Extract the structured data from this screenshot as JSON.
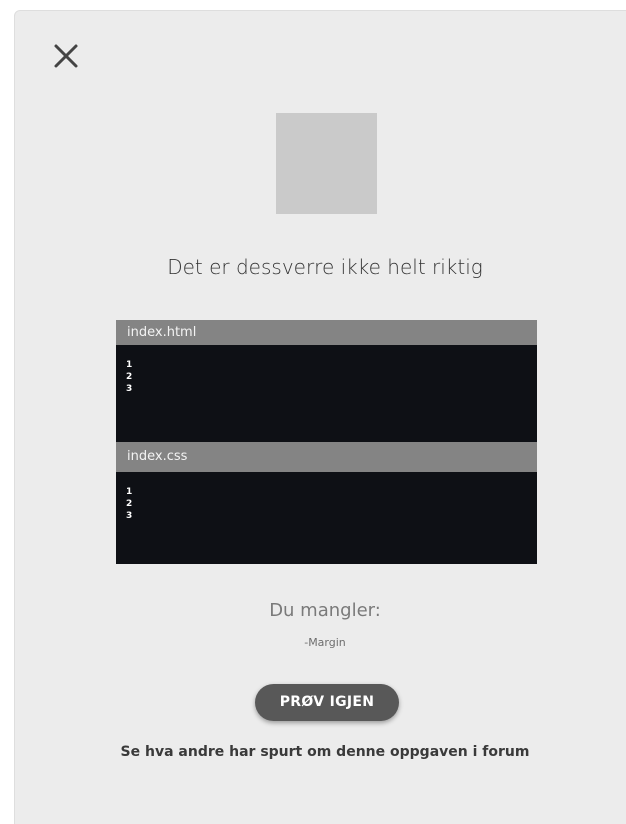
{
  "dialog": {
    "close_icon": "close-icon",
    "headline": "Det er dessverre ikke helt riktig",
    "editors": [
      {
        "tab_label": "index.html",
        "line_numbers": [
          "1",
          "2",
          "3"
        ]
      },
      {
        "tab_label": "index.css",
        "line_numbers": [
          "1",
          "2",
          "3"
        ]
      }
    ],
    "missing_title": "Du mangler:",
    "missing_item": "-Margin",
    "retry_label": "PRØV IGJEN",
    "forum_link": "Se hva andre har spurt om denne oppgaven i forum"
  },
  "colors": {
    "background": "#ececec",
    "editor_bg": "#0e1015",
    "tab_bg": "#848484",
    "button_bg": "#585858",
    "placeholder": "#cacaca"
  }
}
